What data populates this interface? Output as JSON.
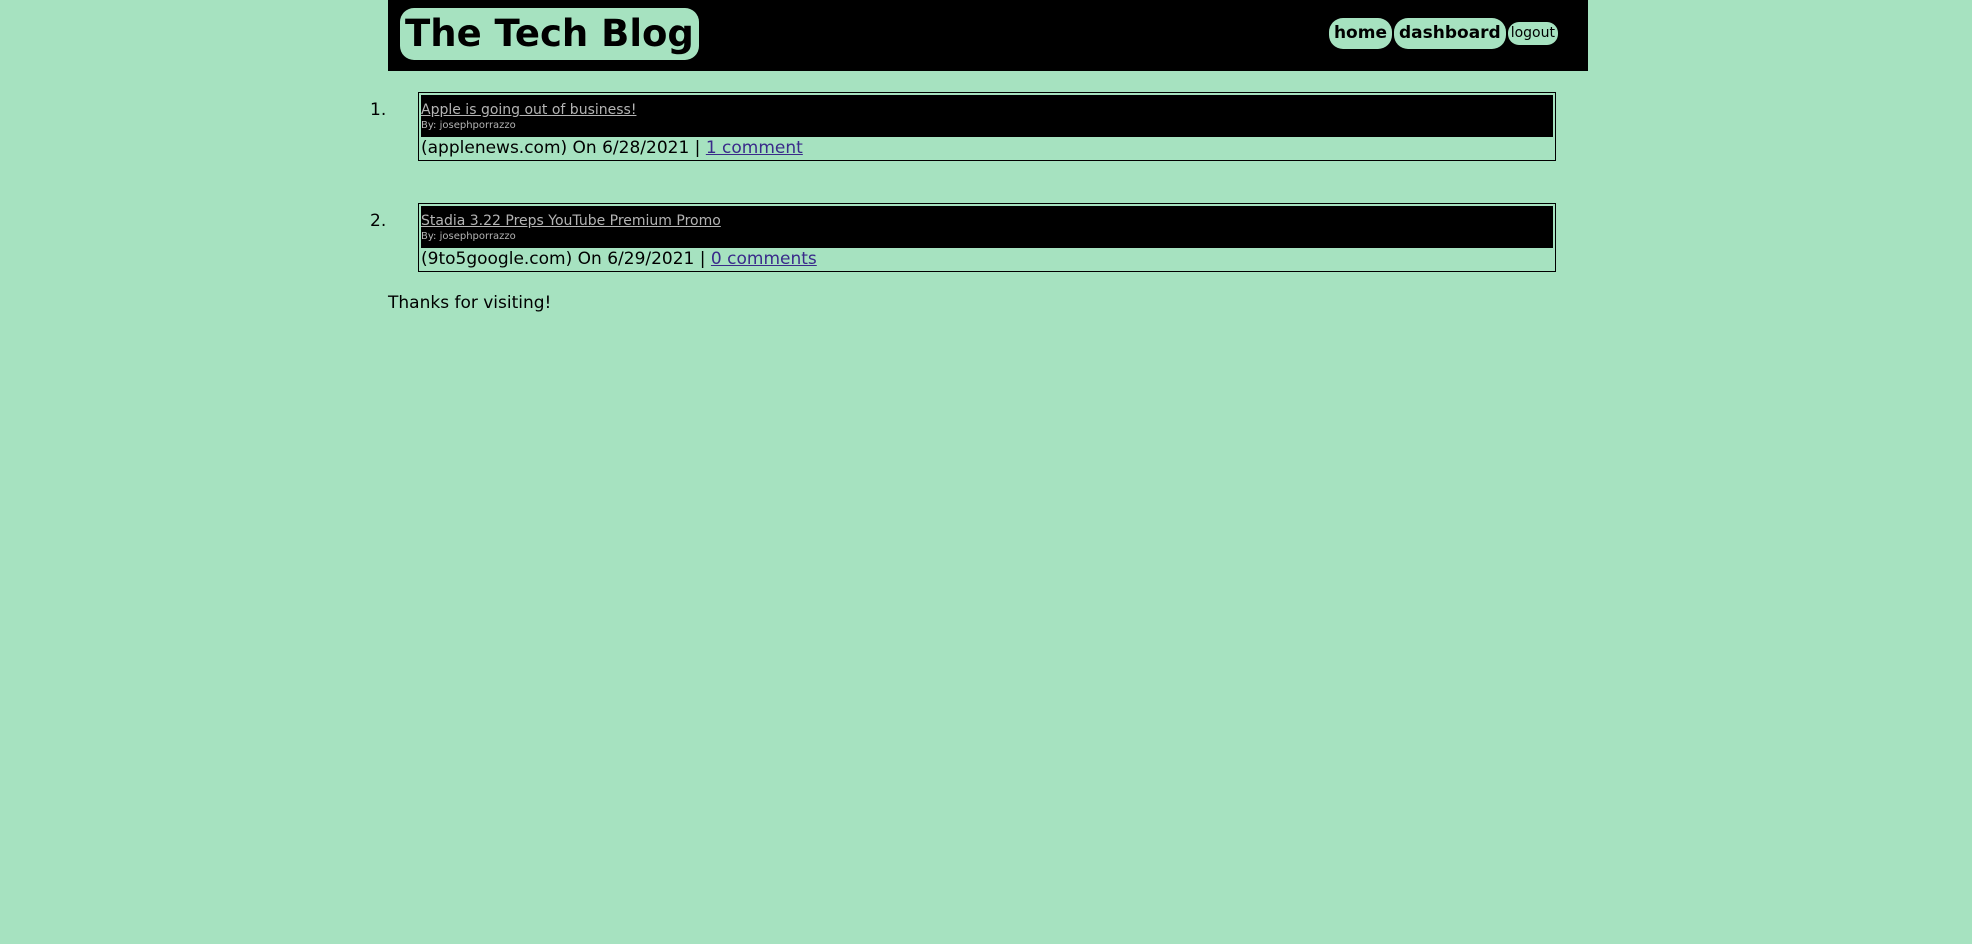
{
  "header": {
    "site_title": "The Tech Blog",
    "nav": {
      "home": "home",
      "dashboard": "dashboard",
      "logout": "logout"
    }
  },
  "posts": [
    {
      "number": "1.",
      "title": "Apple is going out of business!",
      "author": "By: josephporrazzo",
      "source_date": "(applenews.com) On 6/28/2021 |",
      "comments": "1 comment"
    },
    {
      "number": "2.",
      "title": "Stadia 3.22 Preps YouTube Premium Promo",
      "author": "By: josephporrazzo",
      "source_date": "(9to5google.com) On 6/29/2021 |",
      "comments": "0 comments"
    }
  ],
  "footer": {
    "text": "Thanks for visiting!"
  },
  "colors": {
    "background": "#a6e2c0",
    "header_background": "#000000",
    "title_link_text": "#b4b4b4",
    "comment_link": "#3a2a8a"
  }
}
